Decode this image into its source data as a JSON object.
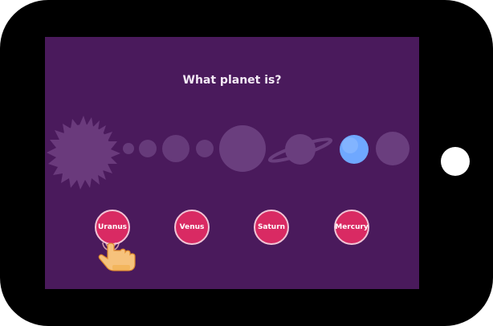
{
  "quiz": {
    "question": "What planet is?",
    "answers": [
      {
        "label": "Uranus"
      },
      {
        "label": "Venus"
      },
      {
        "label": "Saturn"
      },
      {
        "label": "Mercury"
      }
    ],
    "highlighted_planet": "neptune-like blue planet"
  },
  "colors": {
    "screen_bg": "#4a1a5c",
    "answer_bg": "#d92a63",
    "highlight_planet": "#6fa8ff"
  },
  "icons": {
    "pointer": "tap-hand-icon",
    "sun": "sun-icon"
  }
}
